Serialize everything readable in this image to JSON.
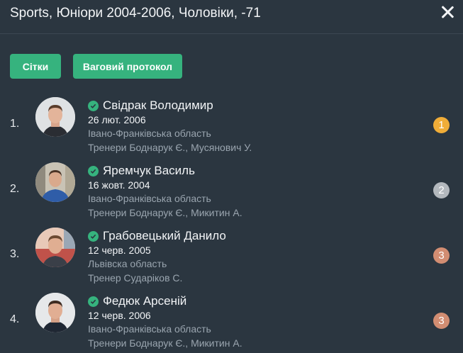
{
  "header": {
    "title": "Sports, Юніори 2004-2006, Чоловіки, -71"
  },
  "buttons": {
    "grids": "Сітки",
    "weight_protocol": "Ваговий протокол"
  },
  "colors": {
    "gold": "#f0ad38",
    "silver": "#b3b8bd",
    "bronze": "#d28d72",
    "accent": "#36b37e"
  },
  "athletes": [
    {
      "rank": "1.",
      "name": "Свідрак Володимир",
      "dob": "26 лют. 2006",
      "region": "Івано-Франківська область",
      "coaches": "Тренери Боднарук Є.,  Мусянович У.",
      "place": "1",
      "medal": "gold"
    },
    {
      "rank": "2.",
      "name": "Яремчук Василь",
      "dob": "16 жовт. 2004",
      "region": "Івано-Франківська область",
      "coaches": "Тренери Боднарук Є.,  Микитин А.",
      "place": "2",
      "medal": "silver"
    },
    {
      "rank": "3.",
      "name": "Грабовецький Данило",
      "dob": "12 черв. 2005",
      "region": "Львівска область",
      "coaches": "Тренер Сударіков С.",
      "place": "3",
      "medal": "bronze"
    },
    {
      "rank": "4.",
      "name": "Федюк Арсеній",
      "dob": "12 черв. 2006",
      "region": "Івано-Франківська область",
      "coaches": "Тренери Боднарук Є.,  Микитин А.",
      "place": "3",
      "medal": "bronze"
    }
  ]
}
